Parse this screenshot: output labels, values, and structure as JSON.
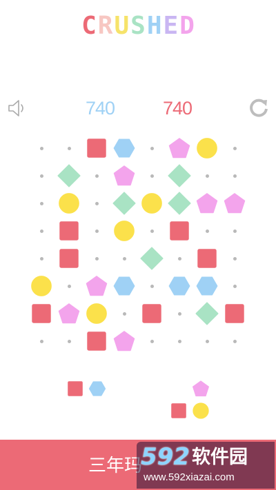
{
  "title": {
    "letters": [
      {
        "char": "C",
        "color": "#ec6a76"
      },
      {
        "char": "R",
        "color": "#f7c7c2"
      },
      {
        "char": "U",
        "color": "#f6e36a"
      },
      {
        "char": "S",
        "color": "#a9e3c4"
      },
      {
        "char": "H",
        "color": "#9fd1f5"
      },
      {
        "char": "E",
        "color": "#c9b6f2"
      },
      {
        "char": "D",
        "color": "#f3a4ec"
      }
    ]
  },
  "toolbar": {
    "sound_icon": "speaker-icon",
    "restart_icon": "restart-icon"
  },
  "scores": {
    "left": {
      "value": "740",
      "color": "#9fd1f5"
    },
    "right": {
      "value": "740",
      "color": "#ec6a76"
    }
  },
  "colors": {
    "square": "#ec6a76",
    "hexagon": "#9fd1f5",
    "pentagon": "#f3a4ec",
    "circle": "#fbe14b",
    "diamond": "#a9e3c4",
    "dot": "#b9b9b9",
    "banner": "#ec6a76"
  },
  "board": {
    "columns": 8,
    "rows": 8,
    "cells": [
      [
        "dot",
        "dot",
        "square",
        "hexagon",
        "dot",
        "pentagon",
        "circle",
        "dot"
      ],
      [
        "dot",
        "diamond",
        "dot",
        "pentagon",
        "dot",
        "diamond",
        "dot",
        "dot"
      ],
      [
        "dot",
        "circle",
        "dot",
        "diamond",
        "circle",
        "diamond",
        "pentagon",
        "pentagon"
      ],
      [
        "dot",
        "square",
        "dot",
        "circle",
        "dot",
        "square",
        "dot",
        "dot"
      ],
      [
        "dot",
        "square",
        "dot",
        "dot",
        "diamond",
        "dot",
        "square",
        "dot"
      ],
      [
        "circle",
        "dot",
        "pentagon",
        "hexagon",
        "dot",
        "hexagon",
        "hexagon",
        "dot"
      ],
      [
        "square",
        "pentagon",
        "circle",
        "dot",
        "square",
        "dot",
        "diamond",
        "square"
      ],
      [
        "dot",
        "dot",
        "square",
        "pentagon",
        "dot",
        "dot",
        "dot",
        "dot"
      ]
    ]
  },
  "tray": {
    "pieces": [
      {
        "shape": "square"
      },
      {
        "shape": "hexagon"
      },
      {
        "shape": "pentagon"
      },
      {
        "shape": "square"
      },
      {
        "shape": "circle"
      }
    ]
  },
  "banner": {
    "text": "三年玛",
    "watermark": {
      "number": "592",
      "name": "软件园",
      "url": "www.592xiazai.com"
    }
  }
}
